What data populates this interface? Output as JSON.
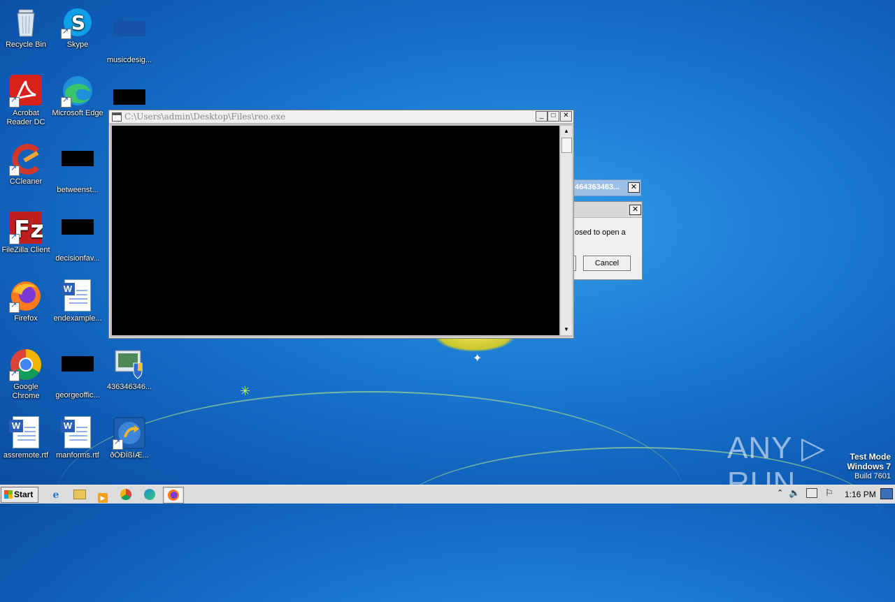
{
  "desktop": {
    "icons": [
      {
        "label": "Recycle Bin"
      },
      {
        "label": "Skype"
      },
      {
        "label": "musicdesig..."
      },
      {
        "label": "Acrobat Reader DC"
      },
      {
        "label": "Microsoft Edge"
      },
      {
        "label": "CCleaner"
      },
      {
        "label": "betweenst..."
      },
      {
        "label": "FileZilla Client"
      },
      {
        "label": "decisionfav..."
      },
      {
        "label": "Firefox"
      },
      {
        "label": "endexample..."
      },
      {
        "label": "Google Chrome"
      },
      {
        "label": "georgeoffic..."
      },
      {
        "label": "436346346..."
      },
      {
        "label": "assremote.rtf"
      },
      {
        "label": "manforms.rtf"
      },
      {
        "label": "ðÕÐÎßÏÆ..."
      }
    ]
  },
  "console": {
    "title": "C:\\Users\\admin\\Desktop\\Files\\reo.exe",
    "minimize": "_",
    "maximize": "□",
    "close": "✕"
  },
  "dialog_back": {
    "title": "464363463...",
    "close": "✕"
  },
  "dialog_front": {
    "message": "osed to open a",
    "cancel": "Cancel",
    "close": "✕"
  },
  "watermark": {
    "text": "ANY ▷ RUN"
  },
  "test_mode": {
    "line1": "Test Mode",
    "line2": "Windows 7",
    "line3": "Build 7601"
  },
  "taskbar": {
    "start_label": "Start",
    "clock": "1:16 PM"
  }
}
